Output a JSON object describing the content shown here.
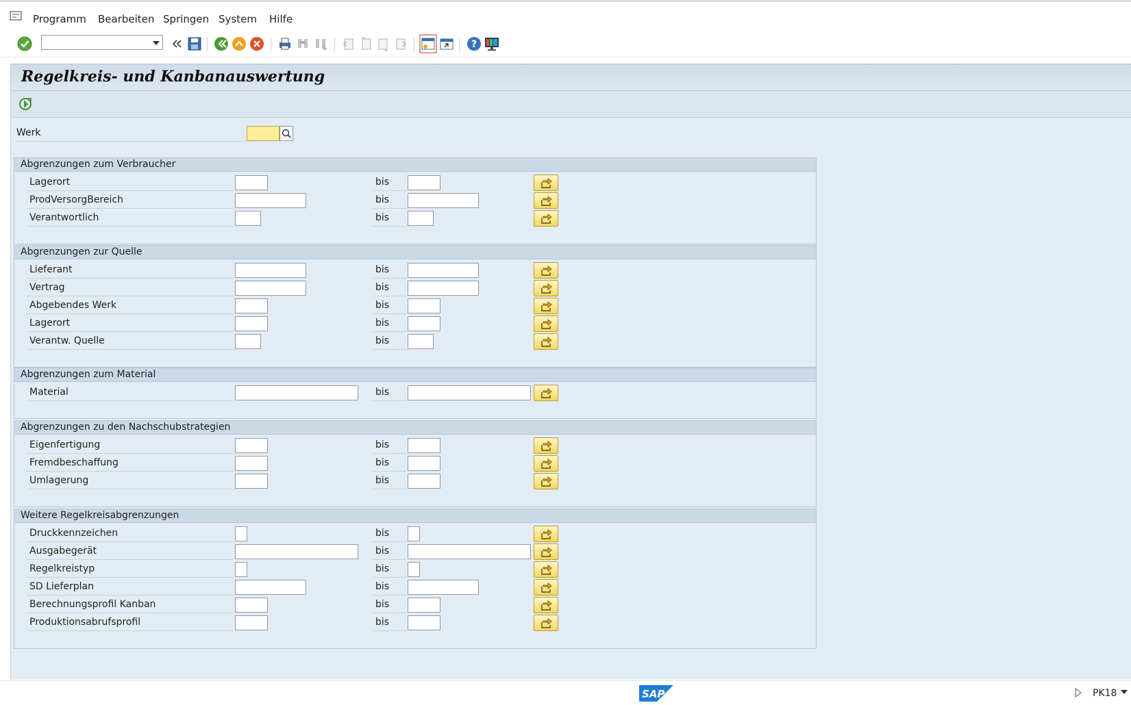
{
  "menu": {
    "items": [
      "Programm",
      "Bearbeiten",
      "Springen",
      "System",
      "Hilfe"
    ]
  },
  "toolbar": {
    "command_field_value": "",
    "icons": [
      "enter-icon",
      "command-dropdown-icon",
      "collapse-icon",
      "save-icon",
      "back-icon",
      "exit-icon",
      "cancel-icon",
      "print-icon",
      "find-icon",
      "find-next-icon",
      "first-page-icon",
      "previous-page-icon",
      "next-page-icon",
      "last-page-icon",
      "create-session-icon",
      "shortcut-icon",
      "help-icon",
      "customize-layout-icon"
    ]
  },
  "page": {
    "title": "Regelkreis- und Kanbanauswertung",
    "werk_label": "Werk",
    "werk_value": ""
  },
  "groups": [
    {
      "title": "Abgrenzungen zum Verbraucher",
      "rows": [
        {
          "label": "Lagerort",
          "from": "",
          "to": "",
          "bis": "bis"
        },
        {
          "label": "ProdVersorgBereich",
          "from": "",
          "to": "",
          "bis": "bis"
        },
        {
          "label": "Verantwortlich",
          "from": "",
          "to": "",
          "bis": "bis"
        }
      ]
    },
    {
      "title": "Abgrenzungen zur Quelle",
      "rows": [
        {
          "label": "Lieferant",
          "from": "",
          "to": "",
          "bis": "bis"
        },
        {
          "label": "Vertrag",
          "from": "",
          "to": "",
          "bis": "bis"
        },
        {
          "label": "Abgebendes Werk",
          "from": "",
          "to": "",
          "bis": "bis"
        },
        {
          "label": "Lagerort",
          "from": "",
          "to": "",
          "bis": "bis"
        },
        {
          "label": "Verantw. Quelle",
          "from": "",
          "to": "",
          "bis": "bis"
        }
      ]
    },
    {
      "title": "Abgrenzungen zum Material",
      "rows": [
        {
          "label": "Material",
          "from": "",
          "to": "",
          "bis": "bis"
        }
      ]
    },
    {
      "title": "Abgrenzungen zu den Nachschubstrategien",
      "rows": [
        {
          "label": "Eigenfertigung",
          "from": "",
          "to": "",
          "bis": "bis"
        },
        {
          "label": "Fremdbeschaffung",
          "from": "",
          "to": "",
          "bis": "bis"
        },
        {
          "label": "Umlagerung",
          "from": "",
          "to": "",
          "bis": "bis"
        }
      ]
    },
    {
      "title": "Weitere Regelkreisabgrenzungen",
      "rows": [
        {
          "label": "Druckkennzeichen",
          "from": "",
          "to": "",
          "bis": "bis"
        },
        {
          "label": "Ausgabegerät",
          "from": "",
          "to": "",
          "bis": "bis"
        },
        {
          "label": "Regelkreistyp",
          "from": "",
          "to": "",
          "bis": "bis"
        },
        {
          "label": "SD Lieferplan",
          "from": "",
          "to": "",
          "bis": "bis"
        },
        {
          "label": "Berechnungsprofil Kanban",
          "from": "",
          "to": "",
          "bis": "bis"
        },
        {
          "label": "Produktionsabrufsprofil",
          "from": "",
          "to": "",
          "bis": "bis"
        }
      ]
    }
  ],
  "status": {
    "logo": "SAP",
    "transaction": "PK18"
  }
}
